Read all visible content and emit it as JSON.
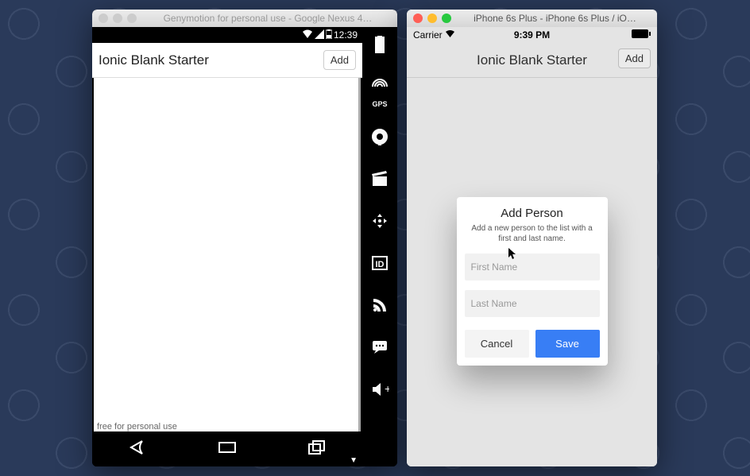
{
  "android_window": {
    "title": "Genymotion for personal use - Google Nexus 4…",
    "status_time": "12:39",
    "header_title": "Ionic Blank Starter",
    "add_label": "Add",
    "watermark": "free for personal use",
    "sidebar": {
      "gps_label": "GPS"
    }
  },
  "ios_window": {
    "title": "iPhone 6s Plus - iPhone 6s Plus / iO…",
    "status_carrier": "Carrier",
    "status_time": "9:39 PM",
    "header_title": "Ionic Blank Starter",
    "add_label": "Add"
  },
  "alert": {
    "title": "Add Person",
    "subtitle": "Add a new person to the list with a first and last name.",
    "first_name_placeholder": "First Name",
    "last_name_placeholder": "Last Name",
    "first_name_value": "",
    "last_name_value": "",
    "cancel_label": "Cancel",
    "save_label": "Save"
  },
  "colors": {
    "primary": "#387ef5"
  }
}
